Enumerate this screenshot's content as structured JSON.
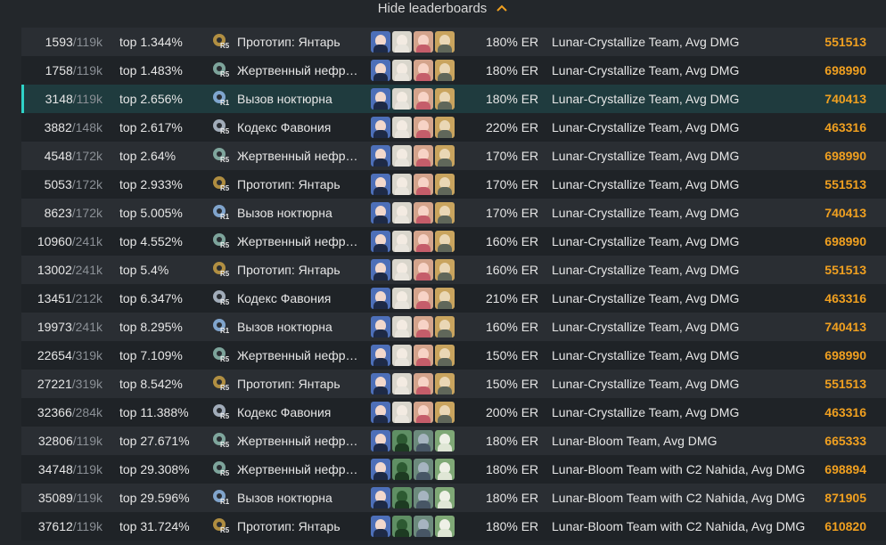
{
  "header": {
    "toggle_label": "Hide leaderboards",
    "toggle_icon": "chevron-up-icon"
  },
  "colors": {
    "accent": "#f0a020",
    "highlight": "#2fd3c8",
    "row_alt": "#2a2e33",
    "row_dark": "#1f2327",
    "highlight_row": "#1f3b3e"
  },
  "rows": [
    {
      "rank": "1593",
      "total": "/119k",
      "top": "top 1.344%",
      "refine": "R5",
      "weapon": "Прототип: Янтарь",
      "weapon_icon": "prototype-amber-icon",
      "team": [
        "blue",
        "white",
        "pink",
        "gold"
      ],
      "er": "180% ER",
      "team_name": "Lunar-Crystallize Team, Avg DMG",
      "dmg": "551513"
    },
    {
      "rank": "1758",
      "total": "/119k",
      "top": "top 1.483%",
      "refine": "R5",
      "weapon": "Жертвенный нефр…",
      "weapon_icon": "sacrificial-jade-icon",
      "team": [
        "blue",
        "white",
        "pink",
        "gold"
      ],
      "er": "180% ER",
      "team_name": "Lunar-Crystallize Team, Avg DMG",
      "dmg": "698990"
    },
    {
      "rank": "3148",
      "total": "/119k",
      "top": "top 2.656%",
      "refine": "R1",
      "weapon": "Вызов ноктюрна",
      "weapon_icon": "nocturne-call-icon",
      "team": [
        "blue",
        "white",
        "pink",
        "gold"
      ],
      "er": "180% ER",
      "team_name": "Lunar-Crystallize Team, Avg DMG",
      "dmg": "740413",
      "highlight": true
    },
    {
      "rank": "3882",
      "total": "/148k",
      "top": "top 2.617%",
      "refine": "R5",
      "weapon": "Кодекс Фавония",
      "weapon_icon": "favonius-codex-icon",
      "team": [
        "blue",
        "white",
        "pink",
        "gold"
      ],
      "er": "220% ER",
      "team_name": "Lunar-Crystallize Team, Avg DMG",
      "dmg": "463316"
    },
    {
      "rank": "4548",
      "total": "/172k",
      "top": "top 2.64%",
      "refine": "R5",
      "weapon": "Жертвенный нефр…",
      "weapon_icon": "sacrificial-jade-icon",
      "team": [
        "blue",
        "white",
        "pink",
        "gold"
      ],
      "er": "170% ER",
      "team_name": "Lunar-Crystallize Team, Avg DMG",
      "dmg": "698990"
    },
    {
      "rank": "5053",
      "total": "/172k",
      "top": "top 2.933%",
      "refine": "R5",
      "weapon": "Прототип: Янтарь",
      "weapon_icon": "prototype-amber-icon",
      "team": [
        "blue",
        "white",
        "pink",
        "gold"
      ],
      "er": "170% ER",
      "team_name": "Lunar-Crystallize Team, Avg DMG",
      "dmg": "551513"
    },
    {
      "rank": "8623",
      "total": "/172k",
      "top": "top 5.005%",
      "refine": "R1",
      "weapon": "Вызов ноктюрна",
      "weapon_icon": "nocturne-call-icon",
      "team": [
        "blue",
        "white",
        "pink",
        "gold"
      ],
      "er": "170% ER",
      "team_name": "Lunar-Crystallize Team, Avg DMG",
      "dmg": "740413"
    },
    {
      "rank": "10960",
      "total": "/241k",
      "top": "top 4.552%",
      "refine": "R5",
      "weapon": "Жертвенный нефр…",
      "weapon_icon": "sacrificial-jade-icon",
      "team": [
        "blue",
        "white",
        "pink",
        "gold"
      ],
      "er": "160% ER",
      "team_name": "Lunar-Crystallize Team, Avg DMG",
      "dmg": "698990"
    },
    {
      "rank": "13002",
      "total": "/241k",
      "top": "top 5.4%",
      "refine": "R5",
      "weapon": "Прототип: Янтарь",
      "weapon_icon": "prototype-amber-icon",
      "team": [
        "blue",
        "white",
        "pink",
        "gold"
      ],
      "er": "160% ER",
      "team_name": "Lunar-Crystallize Team, Avg DMG",
      "dmg": "551513"
    },
    {
      "rank": "13451",
      "total": "/212k",
      "top": "top 6.347%",
      "refine": "R5",
      "weapon": "Кодекс Фавония",
      "weapon_icon": "favonius-codex-icon",
      "team": [
        "blue",
        "white",
        "pink",
        "gold"
      ],
      "er": "210% ER",
      "team_name": "Lunar-Crystallize Team, Avg DMG",
      "dmg": "463316"
    },
    {
      "rank": "19973",
      "total": "/241k",
      "top": "top 8.295%",
      "refine": "R1",
      "weapon": "Вызов ноктюрна",
      "weapon_icon": "nocturne-call-icon",
      "team": [
        "blue",
        "white",
        "pink",
        "gold"
      ],
      "er": "160% ER",
      "team_name": "Lunar-Crystallize Team, Avg DMG",
      "dmg": "740413"
    },
    {
      "rank": "22654",
      "total": "/319k",
      "top": "top 7.109%",
      "refine": "R5",
      "weapon": "Жертвенный нефр…",
      "weapon_icon": "sacrificial-jade-icon",
      "team": [
        "blue",
        "white",
        "pink",
        "gold"
      ],
      "er": "150% ER",
      "team_name": "Lunar-Crystallize Team, Avg DMG",
      "dmg": "698990"
    },
    {
      "rank": "27221",
      "total": "/319k",
      "top": "top 8.542%",
      "refine": "R5",
      "weapon": "Прототип: Янтарь",
      "weapon_icon": "prototype-amber-icon",
      "team": [
        "blue",
        "white",
        "pink",
        "gold"
      ],
      "er": "150% ER",
      "team_name": "Lunar-Crystallize Team, Avg DMG",
      "dmg": "551513"
    },
    {
      "rank": "32366",
      "total": "/284k",
      "top": "top 11.388%",
      "refine": "R5",
      "weapon": "Кодекс Фавония",
      "weapon_icon": "favonius-codex-icon",
      "team": [
        "blue",
        "white",
        "pink",
        "gold"
      ],
      "er": "200% ER",
      "team_name": "Lunar-Crystallize Team, Avg DMG",
      "dmg": "463316"
    },
    {
      "rank": "32806",
      "total": "/119k",
      "top": "top 27.671%",
      "refine": "R5",
      "weapon": "Жертвенный нефр…",
      "weapon_icon": "sacrificial-jade-icon",
      "team": [
        "blue",
        "green",
        "teal",
        "green2"
      ],
      "er": "180% ER",
      "team_name": "Lunar-Bloom Team, Avg DMG",
      "dmg": "665333"
    },
    {
      "rank": "34748",
      "total": "/119k",
      "top": "top 29.308%",
      "refine": "R5",
      "weapon": "Жертвенный нефр…",
      "weapon_icon": "sacrificial-jade-icon",
      "team": [
        "blue",
        "green",
        "teal",
        "green2"
      ],
      "er": "180% ER",
      "team_name": "Lunar-Bloom Team with C2 Nahida, Avg DMG",
      "dmg": "698894"
    },
    {
      "rank": "35089",
      "total": "/119k",
      "top": "top 29.596%",
      "refine": "R1",
      "weapon": "Вызов ноктюрна",
      "weapon_icon": "nocturne-call-icon",
      "team": [
        "blue",
        "green",
        "teal",
        "green2"
      ],
      "er": "180% ER",
      "team_name": "Lunar-Bloom Team with C2 Nahida, Avg DMG",
      "dmg": "871905"
    },
    {
      "rank": "37612",
      "total": "/119k",
      "top": "top 31.724%",
      "refine": "R5",
      "weapon": "Прототип: Янтарь",
      "weapon_icon": "prototype-amber-icon",
      "team": [
        "blue",
        "green",
        "teal",
        "green2"
      ],
      "er": "180% ER",
      "team_name": "Lunar-Bloom Team with C2 Nahida, Avg DMG",
      "dmg": "610820"
    }
  ]
}
